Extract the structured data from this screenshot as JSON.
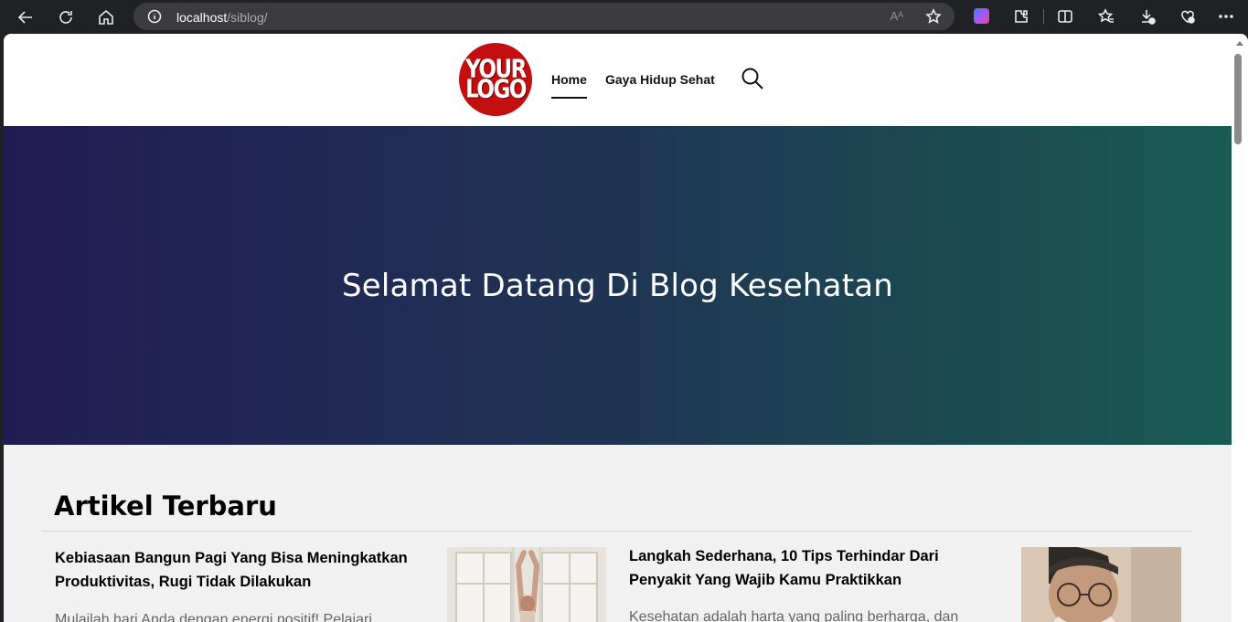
{
  "browser": {
    "url_host": "localhost",
    "url_path": "/siblog/",
    "read_aloud_label": "Aᴬ"
  },
  "site": {
    "logo_line1": "YOUR",
    "logo_line2": "LOGO",
    "menu": [
      {
        "label": "Home",
        "active": true
      },
      {
        "label": "Gaya Hidup Sehat",
        "active": false
      }
    ]
  },
  "hero": {
    "title": "Selamat Datang Di Blog Kesehatan"
  },
  "articles_section": {
    "title": "Artikel Terbaru",
    "items": [
      {
        "title": "Kebiasaan Bangun Pagi Yang Bisa Meningkatkan Produktivitas, Rugi Tidak Dilakukan",
        "excerpt": "Mulailah hari Anda dengan energi positif! Pelajari"
      },
      {
        "title": "Langkah Sederhana, 10 Tips Terhindar Dari Penyakit Yang Wajib Kamu Praktikkan",
        "excerpt": "Kesehatan adalah harta yang paling berharga, dan"
      }
    ]
  },
  "colors": {
    "logo_red": "#c30f0f",
    "hero_left": "#221c55",
    "hero_right": "#1a5b52"
  }
}
